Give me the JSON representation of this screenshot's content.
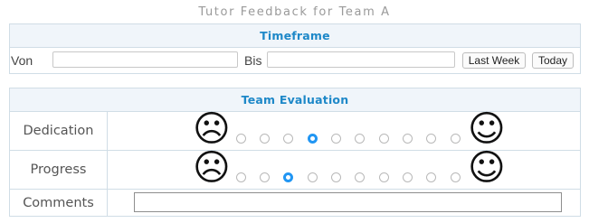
{
  "page": {
    "title": "Tutor Feedback for Team A"
  },
  "timeframe": {
    "header": "Timeframe",
    "from_label": "Von",
    "from_value": "",
    "to_label": "Bis",
    "to_value": "",
    "last_week_label": "Last Week",
    "today_label": "Today"
  },
  "evaluation": {
    "header": "Team Evaluation",
    "rows": [
      {
        "label": "Dedication",
        "options": 10,
        "selected_index": 3,
        "sad_icon": "sad-face-icon",
        "happy_icon": "happy-face-icon"
      },
      {
        "label": "Progress",
        "options": 10,
        "selected_index": 2,
        "sad_icon": "sad-face-icon",
        "happy_icon": "happy-face-icon"
      }
    ],
    "comments_label": "Comments",
    "comments_value": ""
  },
  "colors": {
    "accent": "#1e88c8",
    "radio_selected": "#2196f3",
    "header_bg": "#f0f5fa",
    "border": "#d0dde6"
  }
}
